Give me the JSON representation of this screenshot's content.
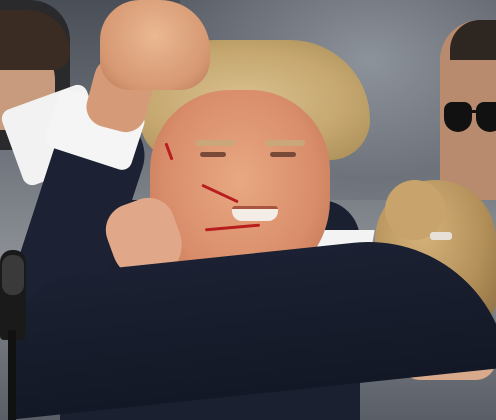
{
  "domain": "Natural-Image",
  "scene": {
    "colors": {
      "suit": "#1a2030",
      "shirt": "#f3f3f3",
      "hair_light": "#d9c08e",
      "skin": "#e0a082",
      "streak": "#b81e1e",
      "background": "#6e737b"
    }
  }
}
